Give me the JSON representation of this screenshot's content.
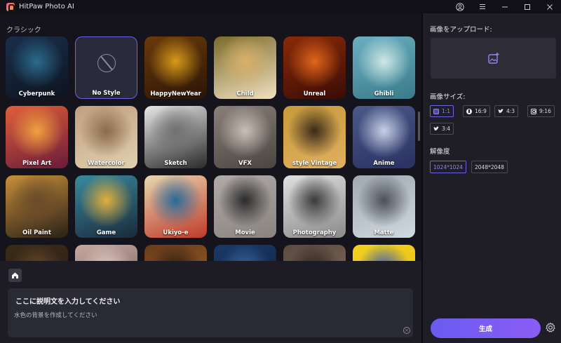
{
  "app": {
    "title": "HitPaw Photo AI"
  },
  "left": {
    "section_label": "クラシック",
    "styles": [
      {
        "label": "Cyberpunk",
        "colors": [
          "#1a2e4a",
          "#2b6b8c",
          "#0d1420"
        ]
      },
      {
        "label": "No Style",
        "colors": [
          "#2a2a3c",
          "#2a2a3c",
          "#2a2a3c"
        ]
      },
      {
        "label": "HappyNewYear",
        "colors": [
          "#6a3a0a",
          "#d99a1a",
          "#2a1508"
        ]
      },
      {
        "label": "Child",
        "colors": [
          "#7a6a2a",
          "#d9b06a",
          "#f0e0c0"
        ]
      },
      {
        "label": "Unreal",
        "colors": [
          "#8a2a0a",
          "#e0661a",
          "#3a0c05"
        ]
      },
      {
        "label": "Ghibli",
        "colors": [
          "#6ab0c0",
          "#d0e8e8",
          "#3a7a8a"
        ]
      },
      {
        "label": "Pixel Art",
        "colors": [
          "#e0603a",
          "#f0a040",
          "#6a1a3a"
        ]
      },
      {
        "label": "Watercolor",
        "colors": [
          "#c0a080",
          "#8a6a4a",
          "#e0d0b0"
        ]
      },
      {
        "label": "Sketch",
        "colors": [
          "#e8e8e8",
          "#707070",
          "#2a2a2a"
        ]
      },
      {
        "label": "VFX",
        "colors": [
          "#8a8078",
          "#c8c0b8",
          "#4a4440"
        ]
      },
      {
        "label": "style Vintage",
        "colors": [
          "#c89a3a",
          "#3a2a1a",
          "#e0b060"
        ]
      },
      {
        "label": "Anime",
        "colors": [
          "#4a5a8a",
          "#c8d0e8",
          "#2a3060"
        ]
      },
      {
        "label": "Oil Paint",
        "colors": [
          "#c8903a",
          "#6a4a2a",
          "#2a2018"
        ]
      },
      {
        "label": "Game",
        "colors": [
          "#3a8aa0",
          "#e0b03a",
          "#1a2a3a"
        ]
      },
      {
        "label": "Ukiyo-e",
        "colors": [
          "#e8d8b0",
          "#2a6a9a",
          "#c03a2a"
        ]
      },
      {
        "label": "Movie",
        "colors": [
          "#b0aaa8",
          "#2a2a2a",
          "#8a8480"
        ]
      },
      {
        "label": "Photography",
        "colors": [
          "#e0e0e0",
          "#3a3a3a",
          "#8a8a8a"
        ]
      },
      {
        "label": "Matte",
        "colors": [
          "#a0a8b0",
          "#4a5058",
          "#d0d8e0"
        ]
      },
      {
        "label": "",
        "colors": [
          "#3a2a18",
          "#6a4a28",
          "#2a2018"
        ]
      },
      {
        "label": "",
        "colors": [
          "#c8a8a0",
          "#e0d0c8",
          "#6a5a58"
        ]
      },
      {
        "label": "",
        "colors": [
          "#6a3a1a",
          "#2a1a10",
          "#a06a2a"
        ]
      },
      {
        "label": "",
        "colors": [
          "#1a3a6a",
          "#3a6aa0",
          "#0a1a3a"
        ]
      },
      {
        "label": "",
        "colors": [
          "#5a4a40",
          "#2a2220",
          "#8a7060"
        ]
      },
      {
        "label": "",
        "colors": [
          "#f0d020",
          "#2a50c0",
          "#e8c010"
        ]
      }
    ],
    "prompt": {
      "title": "ここに説明文を入力してください",
      "text": "水色の背景を作成してください"
    }
  },
  "right": {
    "upload_label": "画像をアップロード:",
    "size_label": "画像サイズ:",
    "sizes": [
      {
        "label": "1:1",
        "icon": "square-icon",
        "active": true
      },
      {
        "label": "16:9",
        "icon": "facebook-icon",
        "active": false
      },
      {
        "label": "4:3",
        "icon": "twitter-icon",
        "active": false
      },
      {
        "label": "9:16",
        "icon": "instagram-icon",
        "active": false
      },
      {
        "label": "3:4",
        "icon": "twitter-icon",
        "active": false
      }
    ],
    "resolution_label": "解像度",
    "resolutions": [
      {
        "label": "1024*1024",
        "active": true
      },
      {
        "label": "2048*2048",
        "active": false
      }
    ],
    "generate_label": "生成"
  },
  "colors": {
    "accent": "#6b62e6",
    "panel": "#1f1e26",
    "background": "#15141c"
  }
}
